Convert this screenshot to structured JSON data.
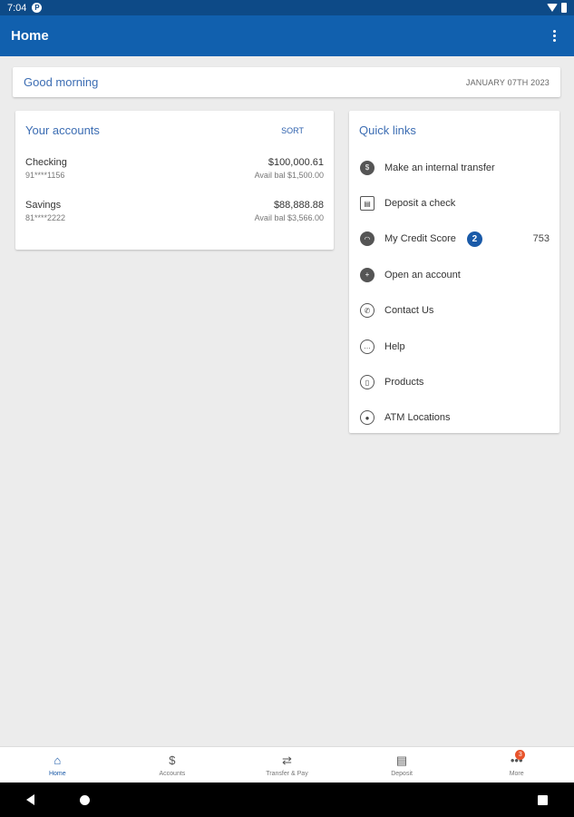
{
  "status_bar": {
    "time": "7:04",
    "notif_icon": "P"
  },
  "app_bar": {
    "title": "Home"
  },
  "greeting": {
    "text": "Good morning",
    "date": "JANUARY 07TH 2023"
  },
  "accounts": {
    "title": "Your accounts",
    "sort_label": "SORT",
    "items": [
      {
        "name": "Checking",
        "number": "91****1156",
        "balance": "$100,000.61",
        "available": "Avail bal $1,500.00"
      },
      {
        "name": "Savings",
        "number": "81****2222",
        "balance": "$88,888.88",
        "available": "Avail bal $3,566.00"
      }
    ]
  },
  "quick_links": {
    "title": "Quick links",
    "items": [
      {
        "label": "Make an internal transfer",
        "icon": "transfer-icon"
      },
      {
        "label": "Deposit a check",
        "icon": "check-deposit-icon"
      },
      {
        "label": "My Credit Score",
        "icon": "gauge-icon",
        "badge": "2",
        "value": "753"
      },
      {
        "label": "Open an account",
        "icon": "add-account-icon"
      },
      {
        "label": "Contact Us",
        "icon": "phone-icon"
      },
      {
        "label": "Help",
        "icon": "chat-icon"
      },
      {
        "label": "Products",
        "icon": "products-icon"
      },
      {
        "label": "ATM Locations",
        "icon": "location-pin-icon"
      }
    ]
  },
  "bottom_nav": {
    "items": [
      {
        "label": "Home",
        "icon": "home-icon"
      },
      {
        "label": "Accounts",
        "icon": "dollar-icon"
      },
      {
        "label": "Transfer & Pay",
        "icon": "transfer-pay-icon"
      },
      {
        "label": "Deposit",
        "icon": "deposit-icon"
      },
      {
        "label": "More",
        "icon": "more-icon",
        "badge": "3"
      }
    ]
  },
  "colors": {
    "appbar": "#1160ae",
    "statusbar": "#0d4a87",
    "accent": "#3c6db3",
    "badge": "#1a5aa8",
    "alert": "#e8542c"
  }
}
